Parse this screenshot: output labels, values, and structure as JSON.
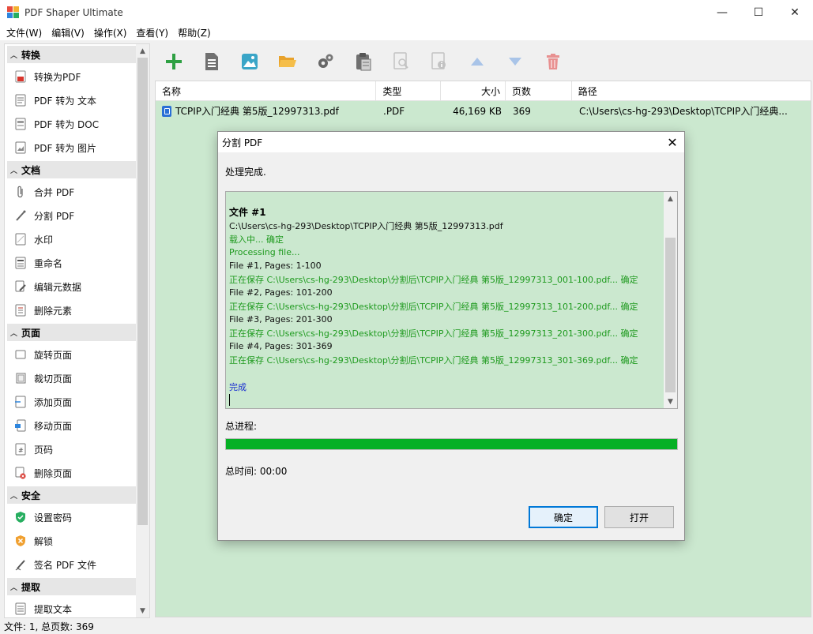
{
  "window": {
    "title": "PDF Shaper Ultimate",
    "controls": {
      "minimize": "—",
      "maximize": "☐",
      "close": "✕"
    }
  },
  "menu": [
    "文件(W)",
    "编辑(V)",
    "操作(X)",
    "查看(Y)",
    "帮助(Z)"
  ],
  "sidebar": {
    "sections": [
      {
        "title": "转换",
        "items": [
          {
            "label": "转换为PDF",
            "icon": "convert-to-pdf-icon"
          },
          {
            "label": "PDF 转为 文本",
            "icon": "pdf-to-text-icon"
          },
          {
            "label": "PDF 转为 DOC",
            "icon": "pdf-to-doc-icon"
          },
          {
            "label": "PDF 转为 图片",
            "icon": "pdf-to-image-icon"
          }
        ]
      },
      {
        "title": "文档",
        "items": [
          {
            "label": "合并 PDF",
            "icon": "paperclip-icon"
          },
          {
            "label": "分割 PDF",
            "icon": "split-icon"
          },
          {
            "label": "水印",
            "icon": "watermark-icon"
          },
          {
            "label": "重命名",
            "icon": "rename-icon"
          },
          {
            "label": "编辑元数据",
            "icon": "edit-metadata-icon"
          },
          {
            "label": "删除元素",
            "icon": "delete-elements-icon"
          }
        ]
      },
      {
        "title": "页面",
        "items": [
          {
            "label": "旋转页面",
            "icon": "rotate-page-icon"
          },
          {
            "label": "裁切页面",
            "icon": "crop-page-icon"
          },
          {
            "label": "添加页面",
            "icon": "add-page-icon"
          },
          {
            "label": "移动页面",
            "icon": "move-page-icon"
          },
          {
            "label": "页码",
            "icon": "page-number-icon"
          },
          {
            "label": "删除页面",
            "icon": "delete-page-icon"
          }
        ]
      },
      {
        "title": "安全",
        "items": [
          {
            "label": "设置密码",
            "icon": "shield-icon"
          },
          {
            "label": "解锁",
            "icon": "unlock-shield-icon"
          },
          {
            "label": "签名 PDF 文件",
            "icon": "sign-pen-icon"
          }
        ]
      },
      {
        "title": "提取",
        "items": [
          {
            "label": "提取文本",
            "icon": "extract-text-icon"
          }
        ]
      }
    ]
  },
  "toolbar": {
    "buttons": [
      "add-icon",
      "document-icon",
      "image-icon",
      "open-folder-icon",
      "settings-gears-icon",
      "paste-icon",
      "search-disabled-icon",
      "info-disabled-icon",
      "move-up-icon",
      "move-down-icon",
      "delete-icon"
    ]
  },
  "filelist": {
    "headers": {
      "name": "名称",
      "type": "类型",
      "size": "大小",
      "pages": "页数",
      "path": "路径"
    },
    "rows": [
      {
        "name": "TCPIP入门经典  第5版_12997313.pdf",
        "type": ".PDF",
        "size": "46,169 KB",
        "pages": "369",
        "path": "C:\\Users\\cs-hg-293\\Desktop\\TCPIP入门经典..."
      }
    ]
  },
  "dialog": {
    "title": "分割 PDF",
    "status": "处理完成.",
    "log": [
      {
        "text": "文件 #1",
        "style": "bold"
      },
      {
        "text": "C:\\Users\\cs-hg-293\\Desktop\\TCPIP入门经典  第5版_12997313.pdf",
        "style": "black"
      },
      {
        "text": "载入中... 确定",
        "style": "green"
      },
      {
        "text": "Processing file...",
        "style": "green"
      },
      {
        "text": "File #1, Pages: 1-100",
        "style": "black"
      },
      {
        "text": "正在保存 C:\\Users\\cs-hg-293\\Desktop\\分割后\\TCPIP入门经典  第5版_12997313_001-100.pdf... 确定",
        "style": "green"
      },
      {
        "text": "File #2, Pages: 101-200",
        "style": "black"
      },
      {
        "text": "正在保存 C:\\Users\\cs-hg-293\\Desktop\\分割后\\TCPIP入门经典  第5版_12997313_101-200.pdf... 确定",
        "style": "green"
      },
      {
        "text": "File #3, Pages: 201-300",
        "style": "black"
      },
      {
        "text": "正在保存 C:\\Users\\cs-hg-293\\Desktop\\分割后\\TCPIP入门经典  第5版_12997313_201-300.pdf... 确定",
        "style": "green"
      },
      {
        "text": "File #4, Pages: 301-369",
        "style": "black"
      },
      {
        "text": "正在保存 C:\\Users\\cs-hg-293\\Desktop\\分割后\\TCPIP入门经典  第5版_12997313_301-369.pdf... 确定",
        "style": "green"
      },
      {
        "text": "",
        "style": "black"
      },
      {
        "text": "完成",
        "style": "blue"
      }
    ],
    "progress_label": "总进程:",
    "progress_value": 1.0,
    "time_label": "总时间: 00:00",
    "ok_label": "确定",
    "open_label": "打开"
  },
  "statusbar": {
    "text": "文件: 1, 总页数: 369"
  },
  "colors": {
    "list_bg": "#cbe8cf",
    "progress": "#06b025",
    "log_green": "#1e9a1e",
    "log_blue": "#1a2fd1"
  }
}
